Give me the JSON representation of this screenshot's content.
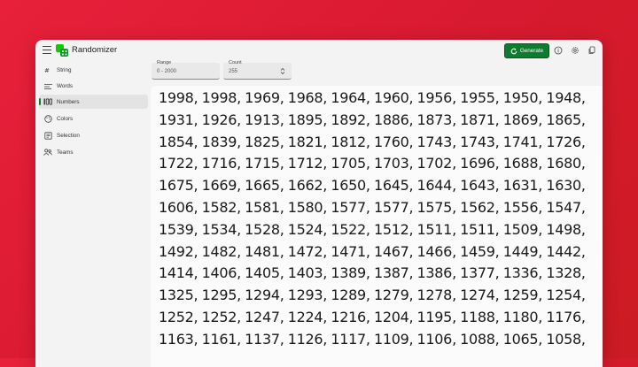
{
  "app": {
    "title": "Randomizer"
  },
  "toolbar": {
    "generate_label": "Generate"
  },
  "sidebar": {
    "items": [
      {
        "label": "String",
        "icon": "string-icon",
        "active": false
      },
      {
        "label": "Words",
        "icon": "words-icon",
        "active": false
      },
      {
        "label": "Numbers",
        "icon": "numbers-icon",
        "active": true
      },
      {
        "label": "Colors",
        "icon": "palette-icon",
        "active": false
      },
      {
        "label": "Selection",
        "icon": "selection-icon",
        "active": false
      },
      {
        "label": "Teams",
        "icon": "teams-icon",
        "active": false
      }
    ]
  },
  "options": {
    "range": {
      "label": "Range",
      "value": "0 - 2000"
    },
    "count": {
      "label": "Count",
      "value": "255"
    }
  },
  "output": {
    "text": "1998, 1998, 1969, 1968, 1964, 1960, 1956, 1955, 1950, 1948, 1931, 1926, 1913, 1895, 1892, 1886, 1873, 1871, 1869, 1865, 1854, 1839, 1825, 1821, 1812, 1760, 1743, 1743, 1741, 1726, 1722, 1716, 1715, 1712, 1705, 1703, 1702, 1696, 1688, 1680, 1675, 1669, 1665, 1662, 1650, 1645, 1644, 1643, 1631, 1630, 1606, 1582, 1581, 1580, 1577, 1577, 1575, 1562, 1556, 1547, 1539, 1534, 1528, 1524, 1522, 1512, 1511, 1511, 1509, 1498, 1492, 1482, 1481, 1472, 1471, 1467, 1466, 1459, 1449, 1442, 1414, 1406, 1405, 1403, 1389, 1387, 1386, 1377, 1336, 1328, 1325, 1295, 1294, 1293, 1289, 1279, 1278, 1274, 1259, 1254, 1252, 1252, 1247, 1224, 1216, 1204, 1195, 1188, 1180, 1176, 1163, 1161, 1137, 1126, 1117, 1109, 1106, 1088, 1065, 1058,"
  },
  "colors": {
    "accent": "#0f7b2e",
    "background": "#e01e35"
  }
}
